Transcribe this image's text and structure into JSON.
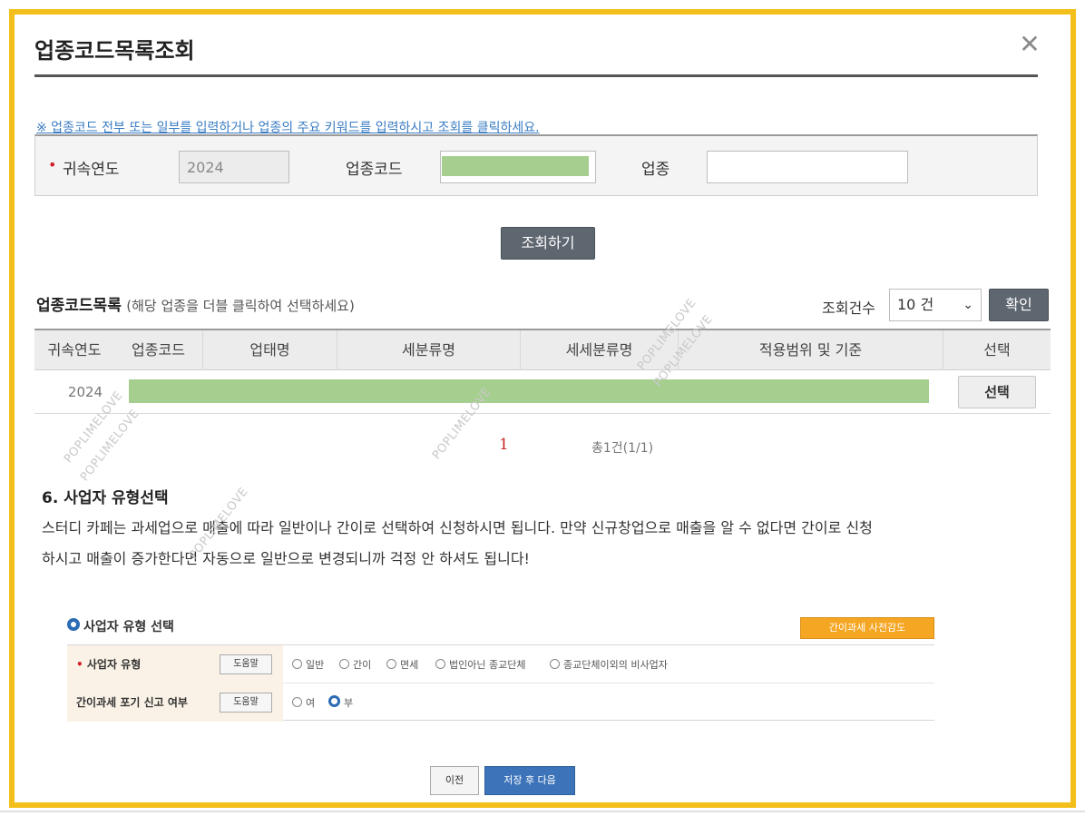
{
  "dialog": {
    "title": "업종코드목록조회",
    "close_icon": "close-icon"
  },
  "notice": "※ 업종코드 전부 또는 일부를 입력하거나 업종의 주요 키워드를 입력하시고 조회를 클릭하세요.",
  "search": {
    "year_label": "귀속연도",
    "year_value": "2024",
    "code_label": "업종코드",
    "code_value": "",
    "biz_label": "업종",
    "biz_value": "",
    "search_button": "조회하기"
  },
  "list": {
    "title": "업종코드목록",
    "subtitle": "(해당 업종을 더블 클릭하여 선택하세요)",
    "count_label": "조회건수",
    "count_value": "10 건",
    "confirm_button": "확인",
    "columns": [
      "귀속연도",
      "업종코드",
      "업태명",
      "세분류명",
      "세세분류명",
      "적용범위 및 기준",
      "선택"
    ],
    "rows": [
      {
        "year": "2024",
        "select_label": "선택"
      }
    ],
    "page_current": "1",
    "page_total": "총1건(1/1)"
  },
  "section": {
    "title": "6. 사업자 유형선택",
    "para_line1": "스터디 카페는 과세업으로 매출에 따라 일반이나 간이로 선택하여 신청하시면 됩니다. 만약 신규창업으로 매출을 알 수 없다면 간이로 신청",
    "para_line2": "하시고 매출이 증가한다면 자동으로 일반으로 변경되니까 걱정 안 하셔도 됩니다!"
  },
  "panel": {
    "title": "사업자 유형 선택",
    "orange_button": "간이과세 사전감도",
    "row1_label": "사업자 유형",
    "row1_help": "도움말",
    "row1_options": [
      "일반",
      "간이",
      "면세",
      "법인아닌 종교단체",
      "종교단체이외의 비사업자"
    ],
    "row2_label": "간이과세 포기 신고 여부",
    "row2_help": "도움말",
    "row2_options": [
      "여",
      "부"
    ],
    "prev_button": "이전",
    "next_button": "저장 후 다음"
  },
  "watermark": "POPLIMELOVE",
  "colors": {
    "frame": "#f3bf1b",
    "mask": "#a6cf8f",
    "notice": "#3a7cc3",
    "primary": "#3d73b8",
    "dark_button": "#5e6670",
    "orange": "#f5a623",
    "page_current": "#c32828"
  }
}
